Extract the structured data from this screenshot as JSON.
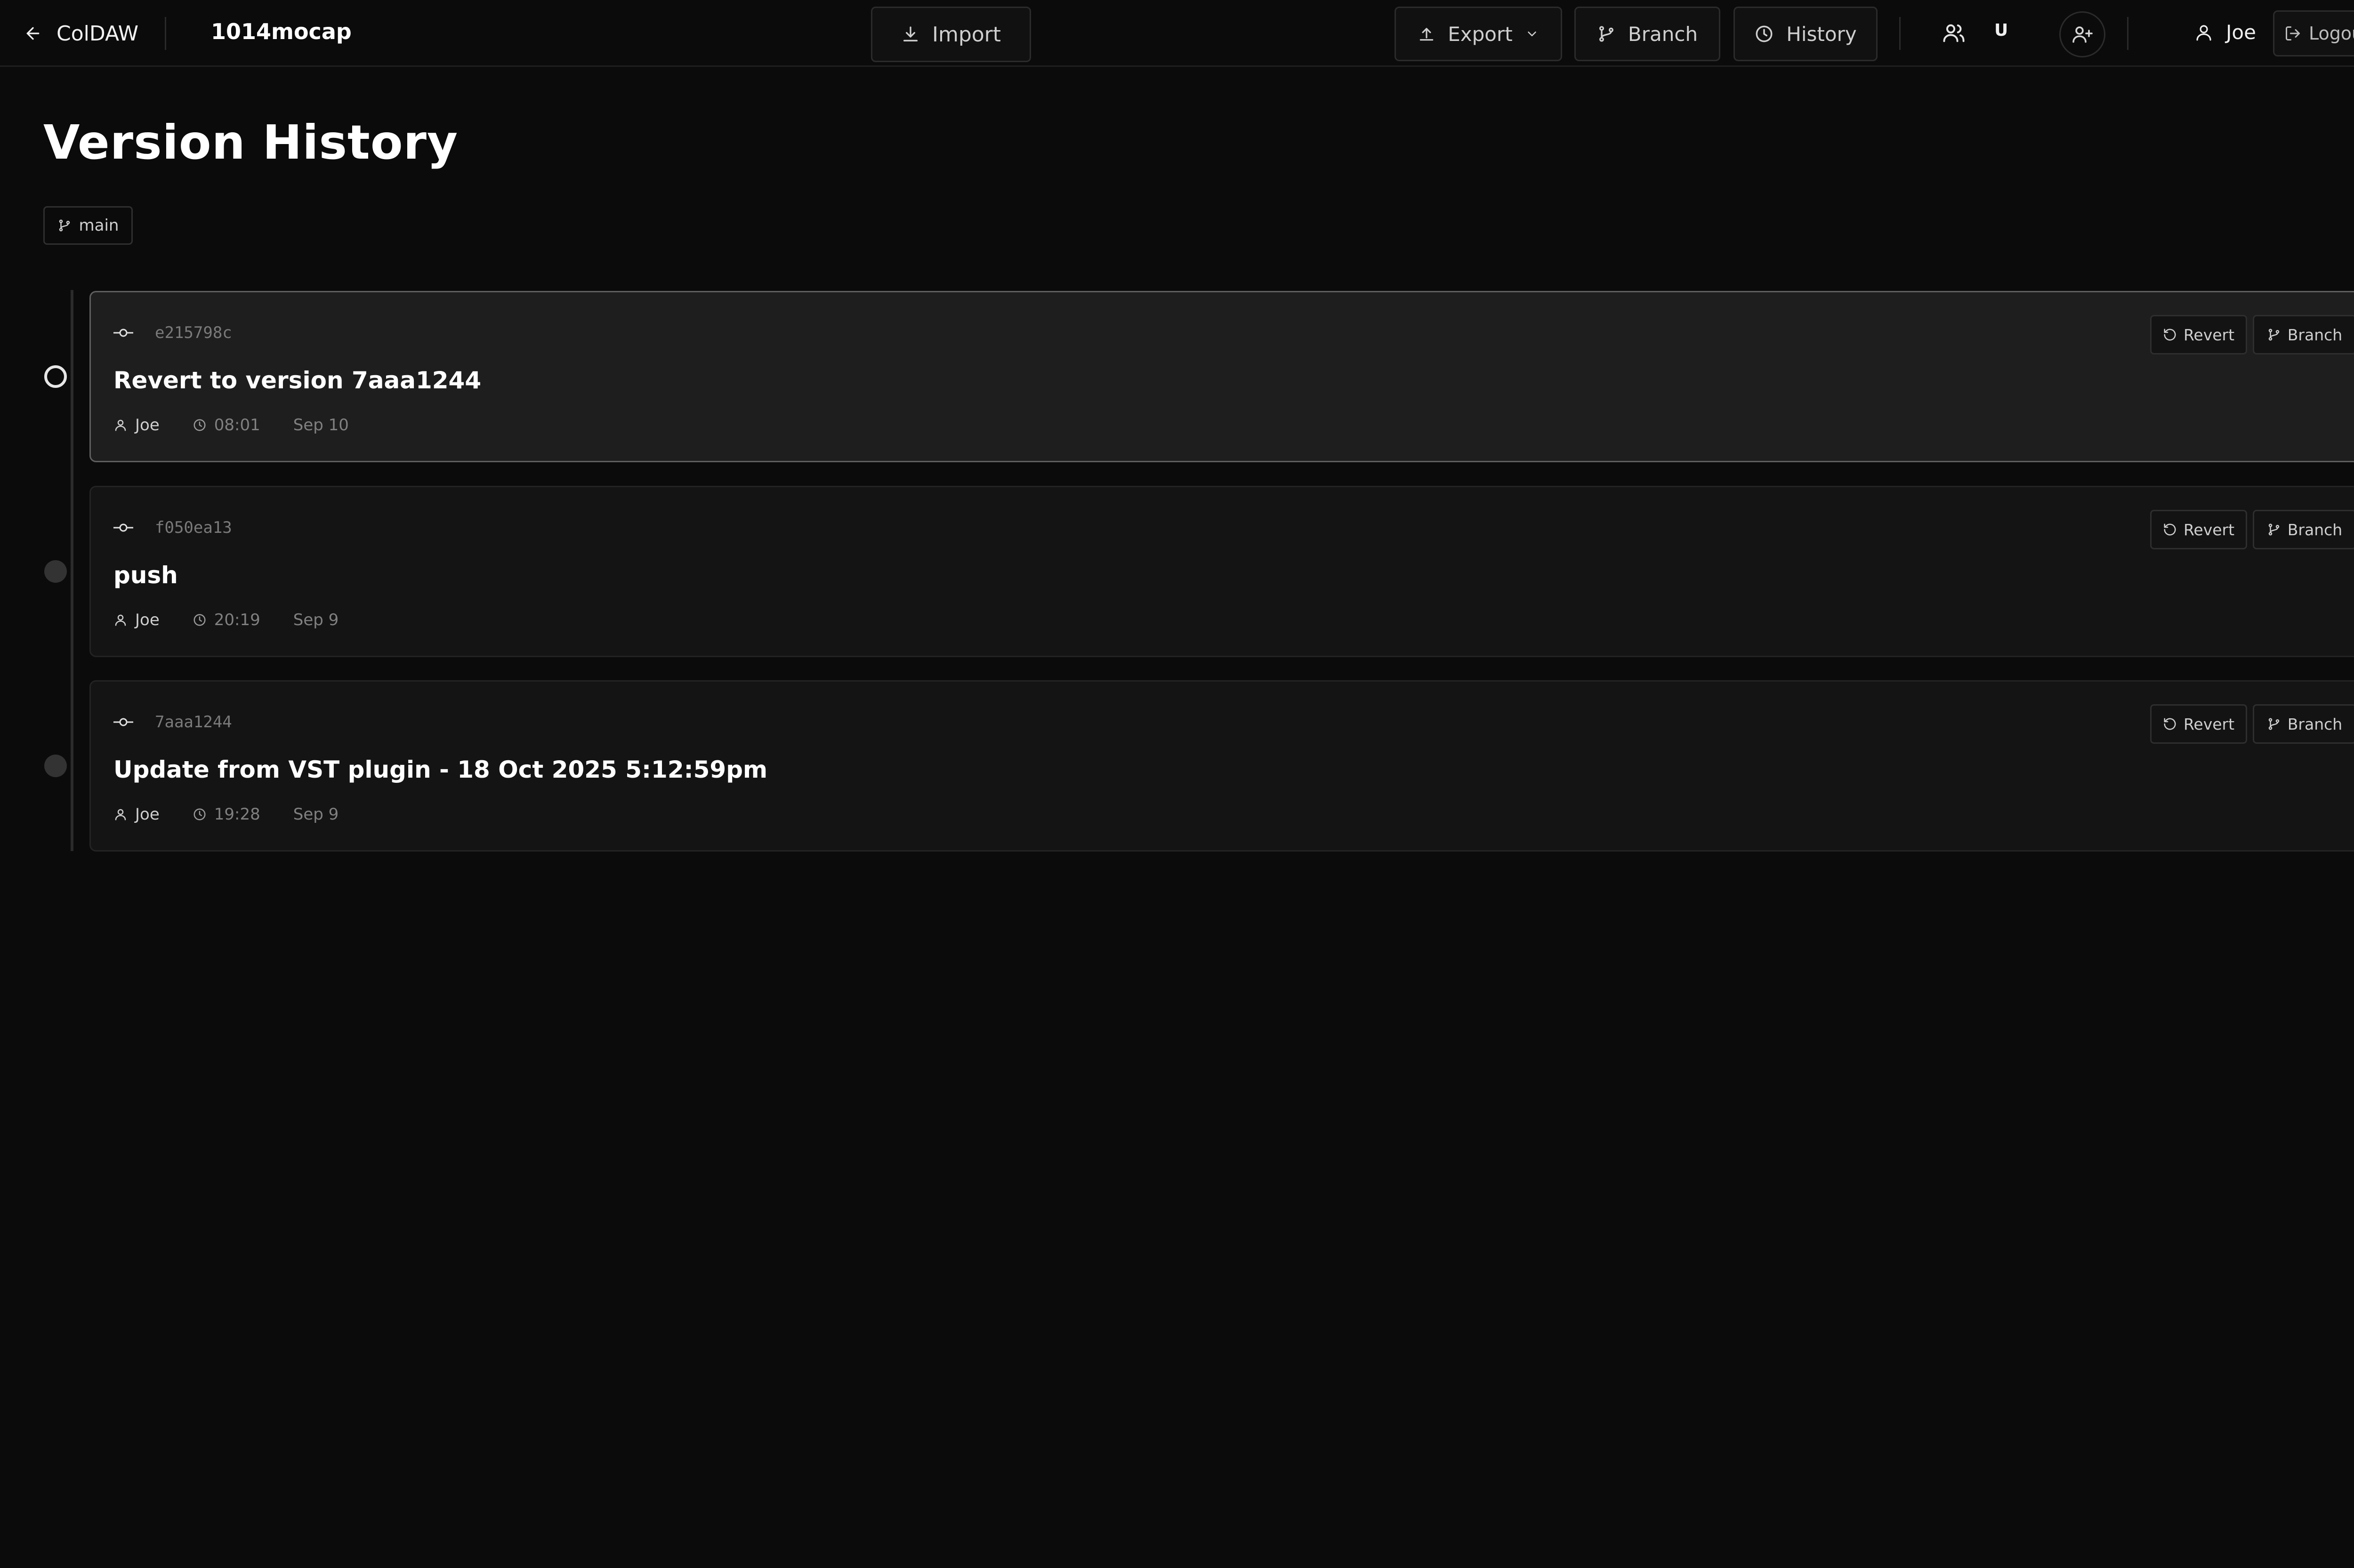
{
  "header": {
    "app_name": "ColDAW",
    "project_name": "1014mocap",
    "import_label": "Import",
    "export_label": "Export",
    "branch_label": "Branch",
    "history_label": "History",
    "user_initial": "U",
    "username": "Joe",
    "logout_label": "Logout"
  },
  "page": {
    "title": "Version History",
    "branch": "main"
  },
  "commits": [
    {
      "hash": "e215798c",
      "message": "Revert to version 7aaa1244",
      "author": "Joe",
      "time": "08:01",
      "date": "Sep 10",
      "revert_label": "Revert",
      "branch_label": "Branch",
      "current": true
    },
    {
      "hash": "f050ea13",
      "message": "push",
      "author": "Joe",
      "time": "20:19",
      "date": "Sep 9",
      "revert_label": "Revert",
      "branch_label": "Branch",
      "current": false
    },
    {
      "hash": "7aaa1244",
      "message": "Update from VST plugin - 18 Oct 2025 5:12:59pm",
      "author": "Joe",
      "time": "19:28",
      "date": "Sep 9",
      "revert_label": "Revert",
      "branch_label": "Branch",
      "current": false
    }
  ],
  "icons": {
    "back": "arrow-left-icon",
    "import": "download-icon",
    "export": "upload-icon",
    "branch": "git-branch-icon",
    "history": "clock-icon",
    "collaborators": "users-icon",
    "add_user": "user-plus-icon",
    "user": "user-icon",
    "logout": "logout-icon",
    "commit": "git-commit-icon",
    "revert": "rotate-ccw-icon"
  },
  "colors": {
    "background": "#0b0b0b",
    "card": "#141414",
    "card_active": "#1e1e1e",
    "border": "#2b2b2b",
    "text": "#ffffff",
    "muted": "#7a7a7a"
  }
}
